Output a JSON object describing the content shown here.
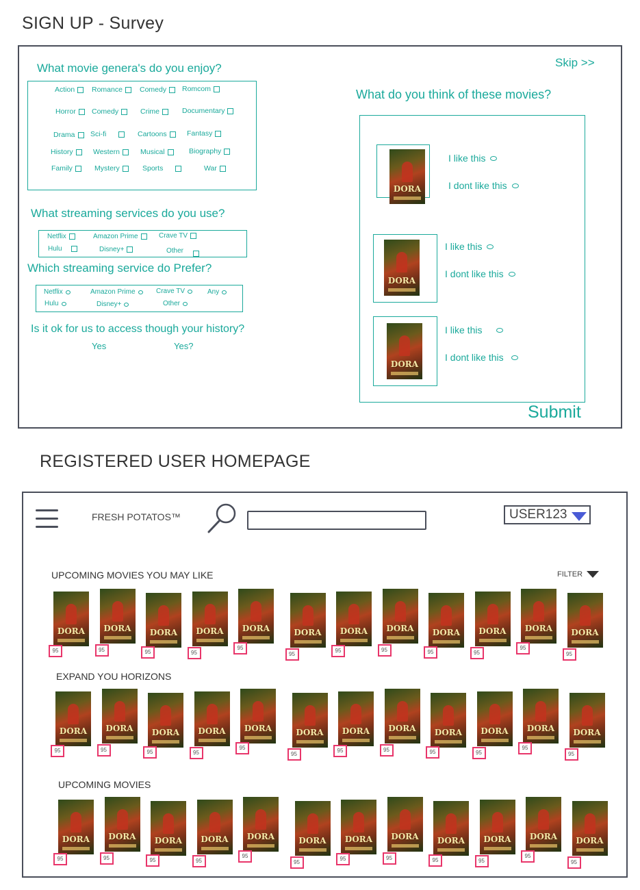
{
  "signup": {
    "title": "SIGN UP - Survey",
    "skip": "Skip >>",
    "genres_question": "What movie genera's do you enjoy?",
    "genres": [
      "Action",
      "Romance",
      "Comedy",
      "Romcom",
      "Horror",
      "Comedy",
      "Crime",
      "Documentary",
      "Drama",
      "Sci-fi",
      "Cartoons",
      "Fantasy",
      "History",
      "Western",
      "Musical",
      "Biography",
      "Family",
      "Mystery",
      "Sports",
      "War"
    ],
    "services_question": "What streaming services do you use?",
    "services": [
      "Netflix",
      "Amazon Prime",
      "Crave TV",
      "Hulu",
      "Disney+",
      "Other"
    ],
    "prefer_question": "Which streaming service do Prefer?",
    "prefer_options": [
      "Netflix",
      "Amazon Prime",
      "Crave TV",
      "Any",
      "Hulu",
      "Disney+",
      "Other"
    ],
    "history_question": "Is it ok for us to access though your history?",
    "history_options": [
      "Yes",
      "Yes?"
    ],
    "movies_question": "What do you think of these movies?",
    "like": "I like this",
    "dislike": "I dont like this",
    "submit": "Submit"
  },
  "poster_title": "DORA",
  "home": {
    "title": "REGISTERED USER HOMEPAGE",
    "brand": "FRESH POTATOS™",
    "search_placeholder": "",
    "user": "USER123",
    "filter": "FILTER",
    "rows": [
      {
        "title": "UPCOMING MOVIES YOU MAY LIKE",
        "scores": [
          "95",
          "95",
          "95",
          "95",
          "95",
          "95",
          "95",
          "95",
          "95",
          "95",
          "95",
          "95"
        ]
      },
      {
        "title": "EXPAND YOU HORIZONS",
        "scores": [
          "95",
          "95",
          "95",
          "95",
          "95",
          "95",
          "95",
          "95",
          "95",
          "95",
          "95",
          "95"
        ]
      },
      {
        "title": "UPCOMING MOVIES",
        "scores": [
          "95",
          "95",
          "95",
          "95",
          "95",
          "95",
          "95",
          "95",
          "95",
          "95",
          "95",
          "95"
        ]
      }
    ]
  },
  "colors": {
    "accent": "#1aa99b",
    "score_border": "#e8356a",
    "dropdown": "#4a5bd6",
    "frame": "#4a4e5a"
  }
}
